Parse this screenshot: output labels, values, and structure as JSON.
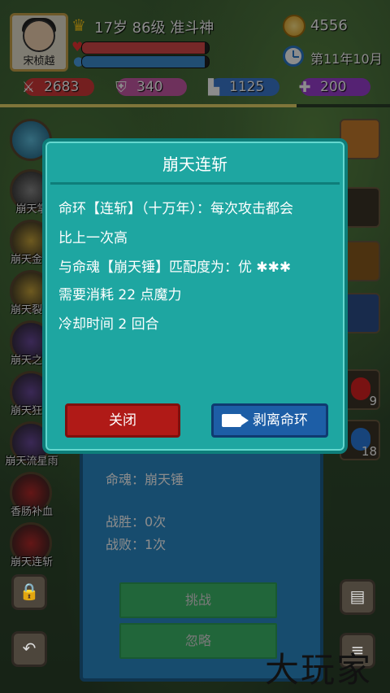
{
  "player": {
    "name": "宋桢越",
    "title_line": "17岁 86级 准斗神",
    "hp_fraction": 0.97,
    "mp_fraction": 0.97
  },
  "resources": {
    "coins": "4556",
    "date": "第11年10月"
  },
  "stats": [
    {
      "name": "attack",
      "value": "2683",
      "icon": "sword-icon",
      "color": "#d43a3a"
    },
    {
      "name": "defense",
      "value": "340",
      "icon": "shield-icon",
      "color": "#c95aa8"
    },
    {
      "name": "speed",
      "value": "1125",
      "icon": "boot-icon",
      "color": "#3b7ad1"
    },
    {
      "name": "hp",
      "value": "200",
      "icon": "heart-icon",
      "color": "#9c3fd1"
    }
  ],
  "progress_fraction": 0.76,
  "left_skills": [
    "崩天掌",
    "崩天金光",
    "崩天裂刃",
    "崩天之怒",
    "崩天狂斩",
    "崩天流星雨",
    "香肠补血",
    "崩天连斩"
  ],
  "right_items": {
    "potion_red_count": "9",
    "potion_blue_count": "18"
  },
  "back_panel": {
    "soul_line": "命魂：崩天锤",
    "wins": "战胜：0次",
    "losses": "战败：1次",
    "challenge_label": "挑战",
    "ignore_label": "忽略"
  },
  "dialog": {
    "title": "崩天连斩",
    "line1": "命环【连斩】（十万年）：每次攻击都会",
    "line2": "比上一次高",
    "line3": "与命魂【崩天锤】匹配度为：优 ✱✱✱",
    "line4": "需要消耗 22 点魔力",
    "line5": "冷却时间 2 回合",
    "close_label": "关闭",
    "strip_label": "剥离命环"
  },
  "watermark": "大玩家"
}
